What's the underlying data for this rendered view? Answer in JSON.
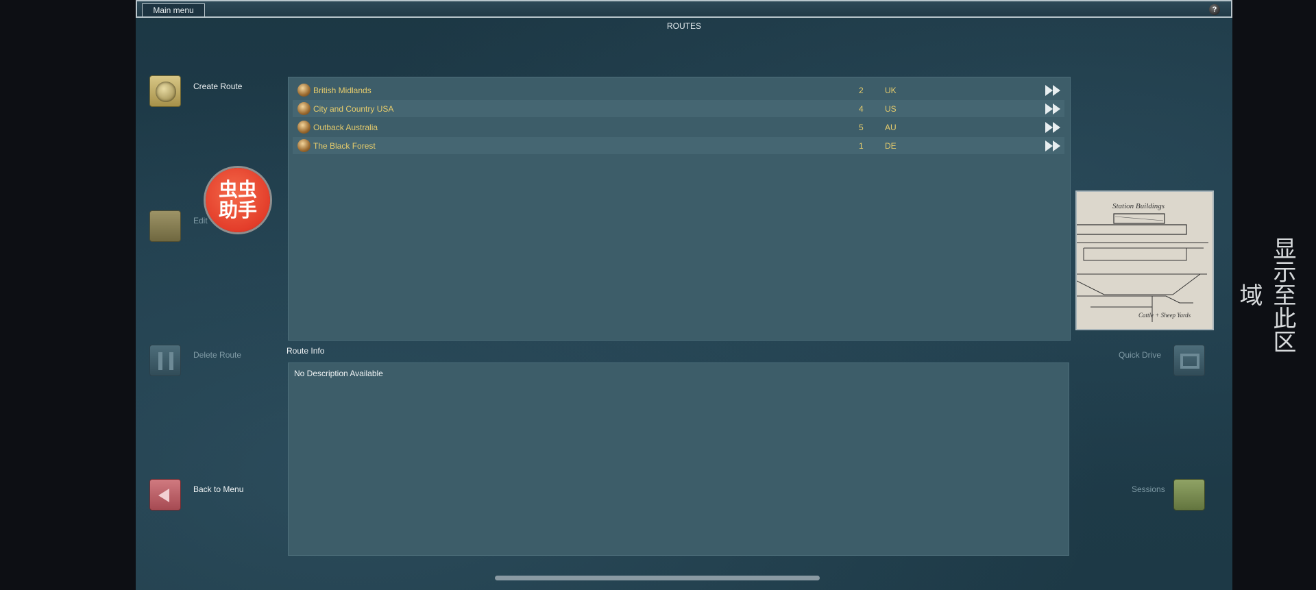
{
  "topbar": {
    "main_menu_label": "Main menu",
    "help_label": "?"
  },
  "page": {
    "title": "ROUTES"
  },
  "side_buttons": {
    "create_label": "Create Route",
    "edit_label": "Edit",
    "delete_label": "Delete Route",
    "back_label": "Back to Menu",
    "quick_drive_label": "Quick Drive",
    "sessions_label": "Sessions"
  },
  "routes": [
    {
      "name": "British  Midlands",
      "count": "2",
      "region": "UK"
    },
    {
      "name": "City  and  Country  USA",
      "count": "4",
      "region": "US"
    },
    {
      "name": "Outback  Australia",
      "count": "5",
      "region": "AU"
    },
    {
      "name": "The  Black  Forest",
      "count": "1",
      "region": "DE"
    }
  ],
  "route_info": {
    "label": "Route Info",
    "description": "No Description Available"
  },
  "preview": {
    "caption_top": "Station Buildings",
    "caption_bottom": "Cattle + Sheep Yards"
  },
  "overlay": {
    "badge_line1": "虫虫",
    "badge_line2": "助手",
    "side_note": "显示至此区域"
  },
  "colors": {
    "route_name": "#e6cc6c",
    "panel": "#3d5d69",
    "background": "#1d3946"
  }
}
